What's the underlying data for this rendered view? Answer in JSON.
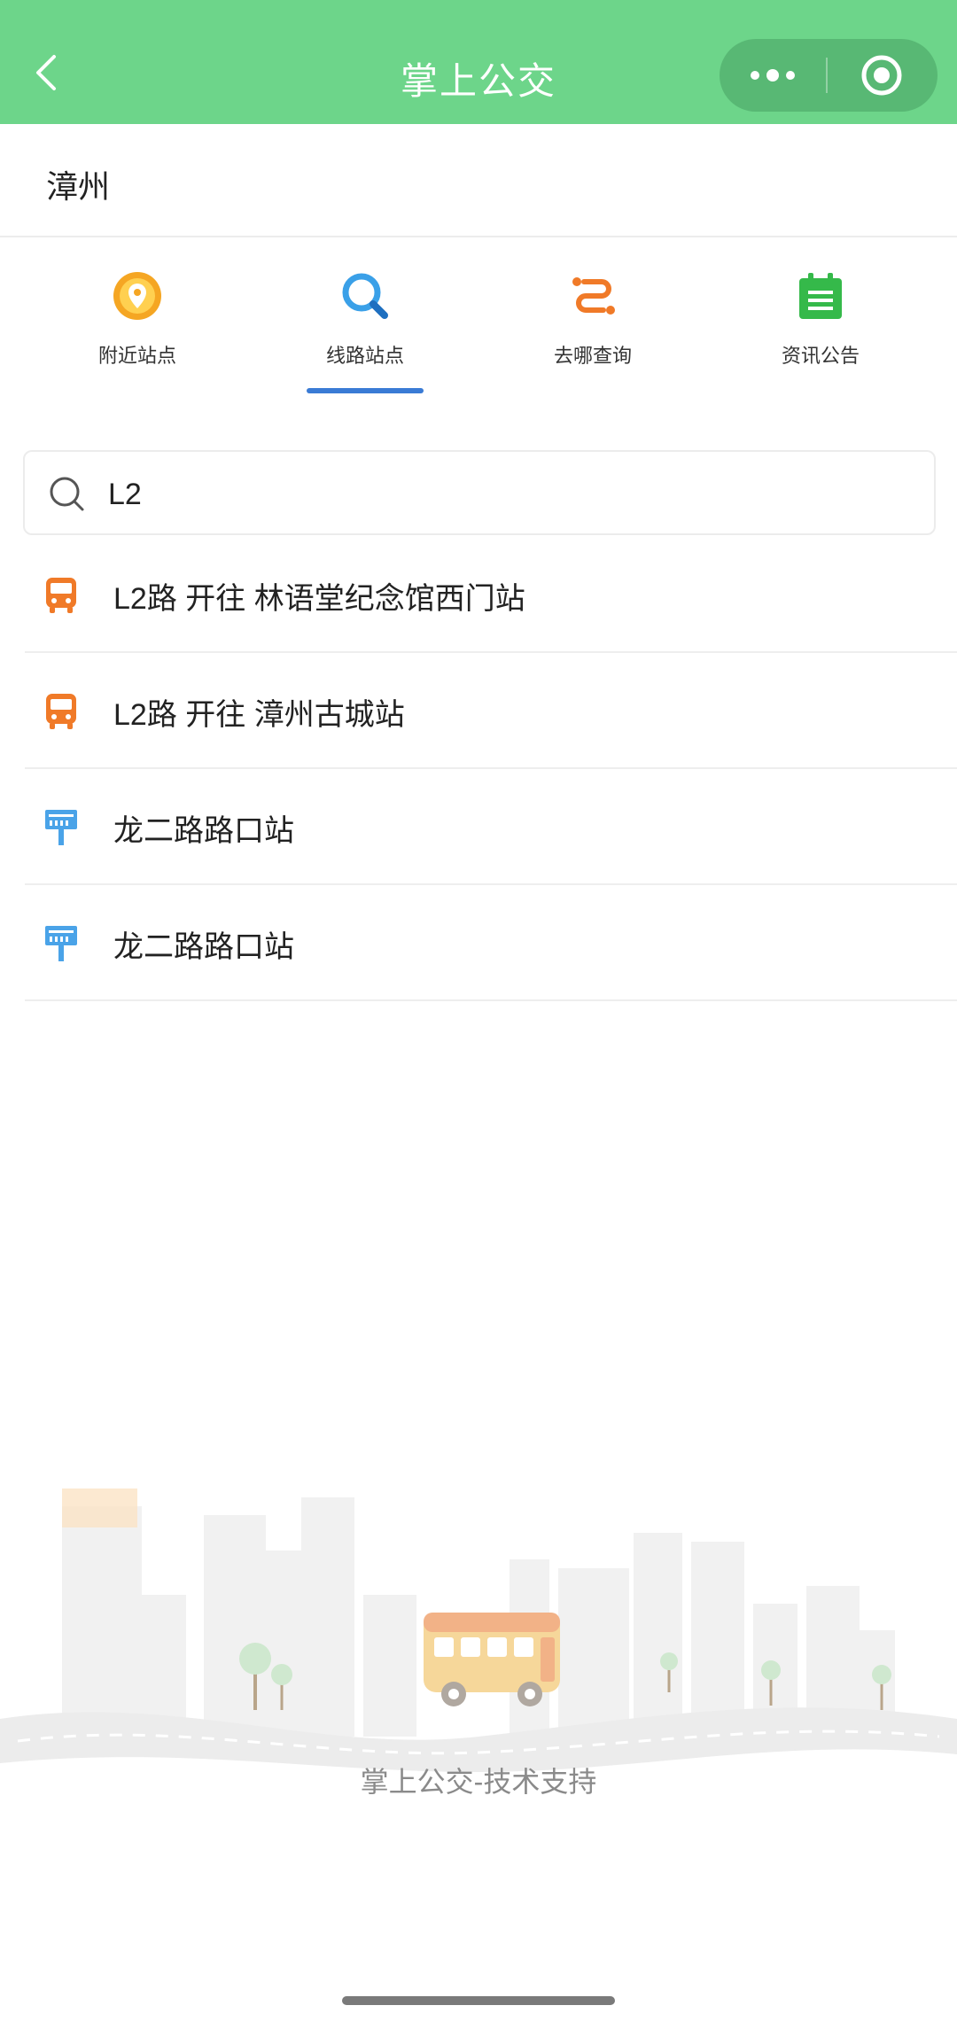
{
  "header": {
    "title": "掌上公交",
    "back_icon": "chevron-left-icon",
    "more_icon": "more-dots-icon",
    "close_icon": "target-circle-icon",
    "background": "#6dd58a"
  },
  "city": {
    "name": "漳州"
  },
  "tabs": [
    {
      "label": "附近站点",
      "icon": "location-pin-icon",
      "color": "#f5a623"
    },
    {
      "label": "线路站点",
      "icon": "search-icon",
      "color": "#3aa0e8",
      "active": true
    },
    {
      "label": "去哪查询",
      "icon": "route-icon",
      "color": "#f07a28"
    },
    {
      "label": "资讯公告",
      "icon": "calendar-icon",
      "color": "#35b94a"
    }
  ],
  "search": {
    "value": "L2",
    "placeholder": ""
  },
  "results": [
    {
      "text": "L2路 开往 林语堂纪念馆西门站",
      "icon": "bus-icon"
    },
    {
      "text": "L2路 开往 漳州古城站",
      "icon": "bus-icon"
    },
    {
      "text": "龙二路路口站",
      "icon": "bus-stop-icon"
    },
    {
      "text": "龙二路路口站",
      "icon": "bus-stop-icon"
    }
  ],
  "footer": {
    "text": "掌上公交-技术支持"
  },
  "colors": {
    "accent_blue": "#3a7bd5",
    "bus_orange": "#f07a28",
    "stop_blue": "#4aa3e8"
  }
}
